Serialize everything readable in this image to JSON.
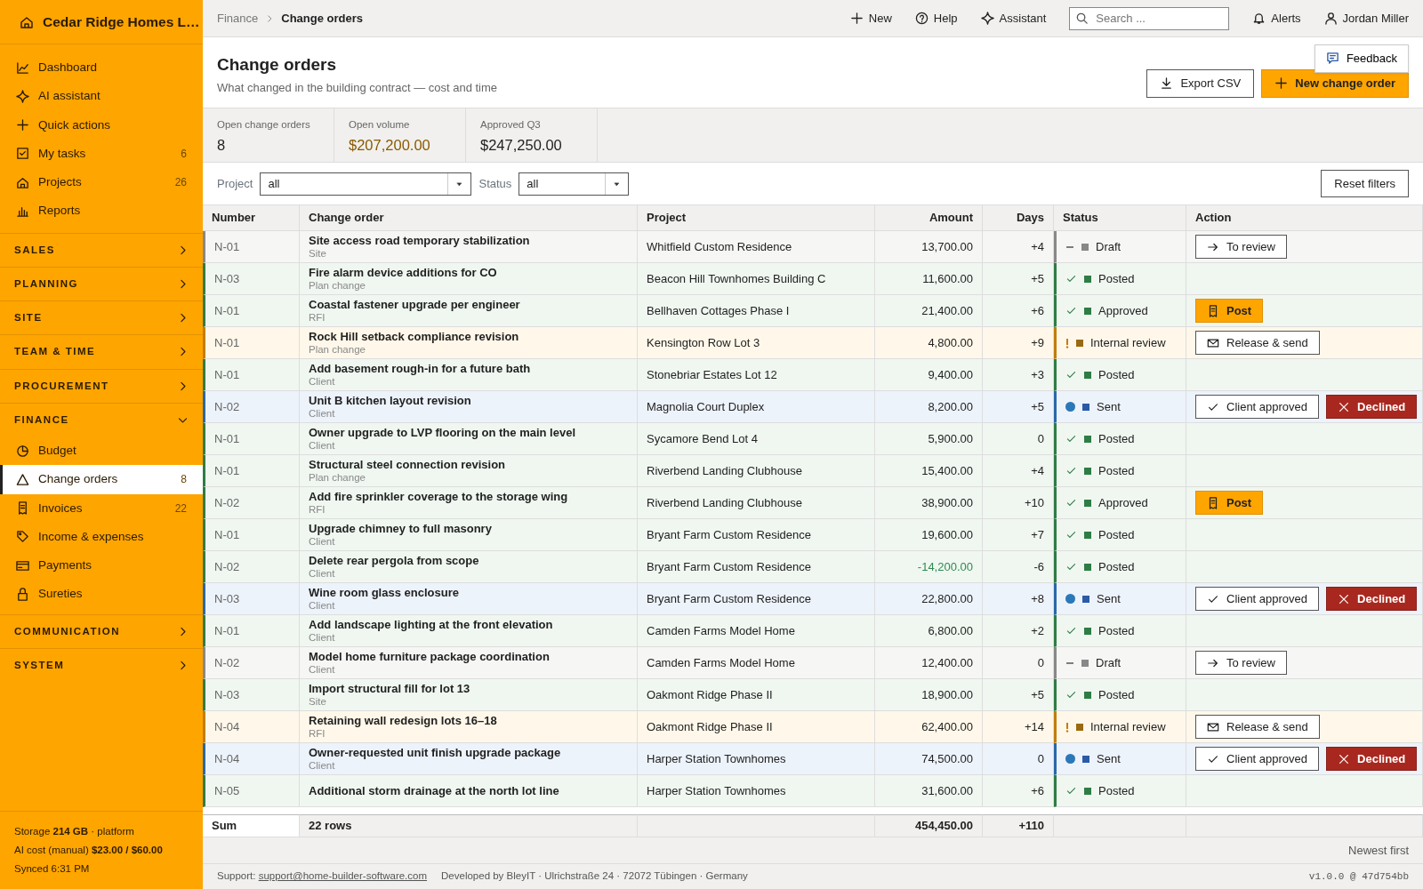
{
  "sidebar": {
    "brand": "Cedar Ridge Homes L…",
    "items": [
      {
        "label": "Dashboard",
        "selected": false
      },
      {
        "label": "AI assistant",
        "selected": false
      },
      {
        "label": "Quick actions",
        "selected": false
      },
      {
        "label": "My tasks",
        "count": "6",
        "selected": false
      },
      {
        "label": "Projects",
        "count": "26",
        "selected": false
      },
      {
        "label": "Reports",
        "selected": false
      }
    ],
    "sections": [
      {
        "label": "SALES",
        "expanded": false
      },
      {
        "label": "PLANNING",
        "expanded": false
      },
      {
        "label": "SITE",
        "expanded": false
      },
      {
        "label": "TEAM & TIME",
        "expanded": false
      },
      {
        "label": "PROCUREMENT",
        "expanded": false
      },
      {
        "label": "FINANCE",
        "expanded": true,
        "children": [
          {
            "label": "Budget",
            "selected": false
          },
          {
            "label": "Change orders",
            "count": "8",
            "selected": true
          },
          {
            "label": "Invoices",
            "count": "22",
            "selected": false
          },
          {
            "label": "Income & expenses",
            "selected": false
          },
          {
            "label": "Payments",
            "selected": false
          },
          {
            "label": "Sureties",
            "selected": false
          }
        ]
      },
      {
        "label": "COMMUNICATION",
        "expanded": false
      },
      {
        "label": "SYSTEM",
        "expanded": false
      }
    ],
    "footer": [
      "Storage **214 GB** · platform",
      "AI cost (manual) **$23.00 / $60.00**",
      "Synced 6:31 PM"
    ]
  },
  "topbar": {
    "breadcrumb": [
      "Finance",
      "Change orders"
    ],
    "actions": [
      "New",
      "Help",
      "Assistant"
    ],
    "search": {
      "placeholder": "Search ..."
    },
    "alerts": "Alerts",
    "user": "Jordan Miller"
  },
  "page": {
    "title": "Change orders",
    "subtitle": "What changed in the building contract — cost and time",
    "buttons": [
      {
        "kind": "export",
        "label": "Export CSV"
      },
      {
        "kind": "primary",
        "label": "New change order"
      }
    ],
    "feedback": "Feedback"
  },
  "kpis": [
    {
      "label": "Open change orders",
      "value": "8",
      "emphasis": false
    },
    {
      "label": "Open volume",
      "value": "$207,200.00",
      "emphasis": true
    },
    {
      "label": "Approved Q3",
      "value": "$247,250.00",
      "emphasis": false
    }
  ],
  "filters": [
    {
      "label": "Project",
      "value": "all"
    },
    {
      "label": "Status",
      "value": "all"
    }
  ],
  "reset": "Reset filters",
  "table": {
    "columns": [
      "Number",
      "Change order",
      "Project",
      "Amount",
      "Days",
      "Status",
      "Action"
    ],
    "rows": [
      {
        "number": "N-01",
        "title": "Site access road temporary stabilization",
        "category": "Site",
        "project": "Whitfield Custom Residence",
        "amount": "13,700.00",
        "credit": false,
        "days": "+4",
        "status": {
          "kind": "draft",
          "label": "Draft"
        },
        "actions": [
          {
            "kind": "review",
            "label": "To review"
          }
        ]
      },
      {
        "number": "N-03",
        "title": "Fire alarm device additions for CO",
        "category": "Plan change",
        "project": "Beacon Hill Townhomes Building C",
        "amount": "11,600.00",
        "credit": false,
        "days": "+5",
        "status": {
          "kind": "posted",
          "label": "Posted"
        }
      },
      {
        "number": "N-01",
        "title": "Coastal fastener upgrade per engineer",
        "category": "RFI",
        "project": "Bellhaven Cottages Phase I",
        "amount": "21,400.00",
        "credit": false,
        "days": "+6",
        "status": {
          "kind": "approved",
          "label": "Approved"
        },
        "actions": [
          {
            "kind": "post",
            "label": "Post"
          }
        ]
      },
      {
        "number": "N-01",
        "title": "Rock Hill setback compliance revision",
        "category": "Plan change",
        "project": "Kensington Row Lot 3",
        "amount": "4,800.00",
        "credit": false,
        "days": "+9",
        "status": {
          "kind": "review",
          "label": "Internal review"
        },
        "actions": [
          {
            "kind": "send",
            "label": "Release & send"
          }
        ]
      },
      {
        "number": "N-01",
        "title": "Add basement rough-in for a future bath",
        "category": "Client",
        "project": "Stonebriar Estates Lot 12",
        "amount": "9,400.00",
        "credit": false,
        "days": "+3",
        "status": {
          "kind": "posted",
          "label": "Posted"
        }
      },
      {
        "number": "N-02",
        "title": "Unit B kitchen layout revision",
        "category": "Client",
        "project": "Magnolia Court Duplex",
        "amount": "8,200.00",
        "credit": false,
        "days": "+5",
        "status": {
          "kind": "sent",
          "label": "Sent"
        },
        "actions": [
          {
            "kind": "approve",
            "label": "Client approved"
          },
          {
            "kind": "decline",
            "label": "Declined"
          }
        ]
      },
      {
        "number": "N-01",
        "title": "Owner upgrade to LVP flooring on the main level",
        "category": "Client",
        "project": "Sycamore Bend Lot 4",
        "amount": "5,900.00",
        "credit": false,
        "days": "0",
        "status": {
          "kind": "posted",
          "label": "Posted"
        }
      },
      {
        "number": "N-01",
        "title": "Structural steel connection revision",
        "category": "Plan change",
        "project": "Riverbend Landing Clubhouse",
        "amount": "15,400.00",
        "credit": false,
        "days": "+4",
        "status": {
          "kind": "posted",
          "label": "Posted"
        }
      },
      {
        "number": "N-02",
        "title": "Add fire sprinkler coverage to the storage wing",
        "category": "RFI",
        "project": "Riverbend Landing Clubhouse",
        "amount": "38,900.00",
        "credit": false,
        "days": "+10",
        "status": {
          "kind": "approved",
          "label": "Approved"
        },
        "actions": [
          {
            "kind": "post",
            "label": "Post"
          }
        ]
      },
      {
        "number": "N-01",
        "title": "Upgrade chimney to full masonry",
        "category": "Client",
        "project": "Bryant Farm Custom Residence",
        "amount": "19,600.00",
        "credit": false,
        "days": "+7",
        "status": {
          "kind": "posted",
          "label": "Posted"
        }
      },
      {
        "number": "N-02",
        "title": "Delete rear pergola from scope",
        "category": "Client",
        "project": "Bryant Farm Custom Residence",
        "amount": "-14,200.00",
        "credit": true,
        "days": "-6",
        "status": {
          "kind": "posted",
          "label": "Posted"
        }
      },
      {
        "number": "N-03",
        "title": "Wine room glass enclosure",
        "category": "Client",
        "project": "Bryant Farm Custom Residence",
        "amount": "22,800.00",
        "credit": false,
        "days": "+8",
        "status": {
          "kind": "sent",
          "label": "Sent"
        },
        "actions": [
          {
            "kind": "approve",
            "label": "Client approved"
          },
          {
            "kind": "decline",
            "label": "Declined"
          }
        ]
      },
      {
        "number": "N-01",
        "title": "Add landscape lighting at the front elevation",
        "category": "Client",
        "project": "Camden Farms Model Home",
        "amount": "6,800.00",
        "credit": false,
        "days": "+2",
        "status": {
          "kind": "posted",
          "label": "Posted"
        }
      },
      {
        "number": "N-02",
        "title": "Model home furniture package coordination",
        "category": "Client",
        "project": "Camden Farms Model Home",
        "amount": "12,400.00",
        "credit": false,
        "days": "0",
        "status": {
          "kind": "draft",
          "label": "Draft"
        },
        "actions": [
          {
            "kind": "review",
            "label": "To review"
          }
        ]
      },
      {
        "number": "N-03",
        "title": "Import structural fill for lot 13",
        "category": "Site",
        "project": "Oakmont Ridge Phase II",
        "amount": "18,900.00",
        "credit": false,
        "days": "+5",
        "status": {
          "kind": "posted",
          "label": "Posted"
        }
      },
      {
        "number": "N-04",
        "title": "Retaining wall redesign lots 16–18",
        "category": "RFI",
        "project": "Oakmont Ridge Phase II",
        "amount": "62,400.00",
        "credit": false,
        "days": "+14",
        "status": {
          "kind": "review",
          "label": "Internal review"
        },
        "actions": [
          {
            "kind": "send",
            "label": "Release & send"
          }
        ]
      },
      {
        "number": "N-04",
        "title": "Owner-requested unit finish upgrade package",
        "category": "Client",
        "project": "Harper Station Townhomes",
        "amount": "74,500.00",
        "credit": false,
        "days": "0",
        "status": {
          "kind": "sent",
          "label": "Sent"
        },
        "actions": [
          {
            "kind": "approve",
            "label": "Client approved"
          },
          {
            "kind": "decline",
            "label": "Declined"
          }
        ]
      },
      {
        "number": "N-05",
        "title": "Additional storm drainage at the north lot line",
        "project": "Harper Station Townhomes",
        "amount": "31,600.00",
        "credit": false,
        "days": "+6",
        "status": {
          "kind": "posted",
          "label": "Posted"
        }
      }
    ],
    "sum": {
      "label": "Sum",
      "rows": "22 rows",
      "amount": "454,450.00",
      "days": "+110"
    }
  },
  "sort": "Newest first",
  "footer": {
    "support": "Support:",
    "email": "support@home-builder-software.com",
    "developer": "Developed by BleyIT · Ulrichstraße 24 · 72072 Tübingen · Germany",
    "version": "v1.0.0 @ 47d754bb"
  }
}
